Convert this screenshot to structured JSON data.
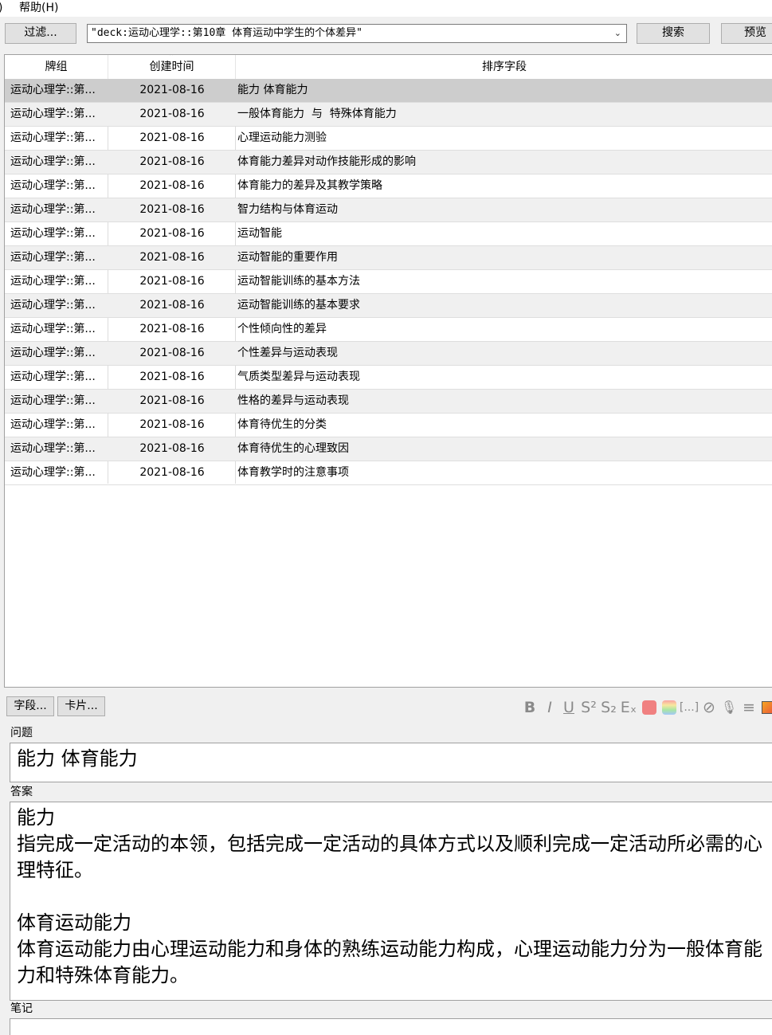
{
  "menu": {
    "partial_left": ")",
    "help": "帮助(H)"
  },
  "toolbar": {
    "filter_label": "过滤...",
    "search_query": "\"deck:运动心理学::第10章 体育运动中学生的个体差异\"",
    "search_label": "搜索",
    "preview_label": "预览"
  },
  "table": {
    "columns": [
      "牌组",
      "创建时间",
      "排序字段"
    ],
    "sort_column": "创建时间",
    "selected_row": 0,
    "rows": [
      {
        "deck": "运动心理学::第...",
        "created": "2021-08-16",
        "sort": "能力 体育能力"
      },
      {
        "deck": "运动心理学::第...",
        "created": "2021-08-16",
        "sort": "一般体育能力  与  特殊体育能力"
      },
      {
        "deck": "运动心理学::第...",
        "created": "2021-08-16",
        "sort": "心理运动能力测验"
      },
      {
        "deck": "运动心理学::第...",
        "created": "2021-08-16",
        "sort": "体育能力差异对动作技能形成的影响"
      },
      {
        "deck": "运动心理学::第...",
        "created": "2021-08-16",
        "sort": "体育能力的差异及其教学策略"
      },
      {
        "deck": "运动心理学::第...",
        "created": "2021-08-16",
        "sort": "智力结构与体育运动"
      },
      {
        "deck": "运动心理学::第...",
        "created": "2021-08-16",
        "sort": "运动智能"
      },
      {
        "deck": "运动心理学::第...",
        "created": "2021-08-16",
        "sort": "运动智能的重要作用"
      },
      {
        "deck": "运动心理学::第...",
        "created": "2021-08-16",
        "sort": "运动智能训练的基本方法"
      },
      {
        "deck": "运动心理学::第...",
        "created": "2021-08-16",
        "sort": "运动智能训练的基本要求"
      },
      {
        "deck": "运动心理学::第...",
        "created": "2021-08-16",
        "sort": "个性倾向性的差异"
      },
      {
        "deck": "运动心理学::第...",
        "created": "2021-08-16",
        "sort": "个性差异与运动表现"
      },
      {
        "deck": "运动心理学::第...",
        "created": "2021-08-16",
        "sort": "气质类型差异与运动表现"
      },
      {
        "deck": "运动心理学::第...",
        "created": "2021-08-16",
        "sort": "性格的差异与运动表现"
      },
      {
        "deck": "运动心理学::第...",
        "created": "2021-08-16",
        "sort": "体育待优生的分类"
      },
      {
        "deck": "运动心理学::第...",
        "created": "2021-08-16",
        "sort": "体育待优生的心理致因"
      },
      {
        "deck": "运动心理学::第...",
        "created": "2021-08-16",
        "sort": "体育教学时的注意事项"
      }
    ]
  },
  "editor": {
    "fields_button": "字段...",
    "cards_button": "卡片...",
    "format_icons": [
      {
        "name": "bold-icon",
        "glyph": "B"
      },
      {
        "name": "italic-icon",
        "glyph": "I"
      },
      {
        "name": "underline-icon",
        "glyph": "U"
      },
      {
        "name": "superscript-icon",
        "glyph": "S²"
      },
      {
        "name": "subscript-icon",
        "glyph": "S₂"
      },
      {
        "name": "clear-format-icon",
        "glyph": "Eₓ"
      },
      {
        "name": "text-color-icon",
        "glyph": ""
      },
      {
        "name": "highlight-color-icon",
        "glyph": ""
      },
      {
        "name": "cloze-icon",
        "glyph": "[...]"
      },
      {
        "name": "attach-icon",
        "glyph": "⊘"
      },
      {
        "name": "record-audio-icon",
        "glyph": "🎙"
      },
      {
        "name": "more-menu-icon",
        "glyph": "≡"
      },
      {
        "name": "image-icon",
        "glyph": ""
      }
    ],
    "colors": {
      "text_color": "#f08080",
      "highlight_stops": [
        "#f9a3a3",
        "#f9e79f",
        "#a8e6a3",
        "#a3c8f9"
      ],
      "selection": "#cdcdcd"
    },
    "fields": [
      {
        "label": "问题",
        "lines": [
          "能力 体育能力"
        ]
      },
      {
        "label": "答案",
        "lines": [
          "能力",
          "指完成一定活动的本领，包括完成一定活动的具体方式以及顺利完成一定活动所必需的心理特征。",
          "",
          "体育运动能力",
          "体育运动能力由心理运动能力和身体的熟练运动能力构成，心理运动能力分为一般体育能力和特殊体育能力。"
        ]
      },
      {
        "label": "笔记",
        "lines": []
      }
    ]
  }
}
